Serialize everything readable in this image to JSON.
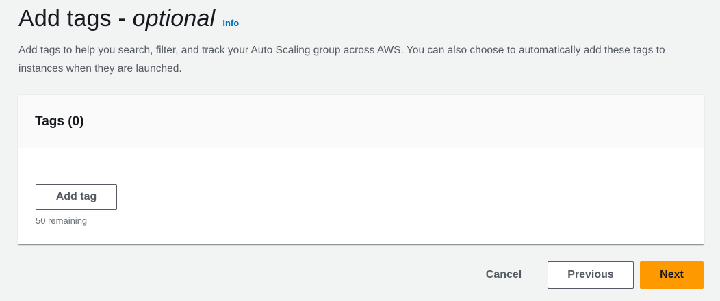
{
  "header": {
    "title_main": "Add tags - ",
    "title_optional": "optional",
    "info_link": "Info",
    "description": "Add tags to help you search, filter, and track your Auto Scaling group across AWS. You can also choose to automatically add these tags to instances when they are launched."
  },
  "tags_panel": {
    "title": "Tags (0)",
    "add_tag_label": "Add tag",
    "remaining_text": "50 remaining"
  },
  "footer": {
    "cancel_label": "Cancel",
    "previous_label": "Previous",
    "next_label": "Next"
  },
  "colors": {
    "background": "#f2f3f3",
    "link": "#0073bb",
    "primary_button": "#ff9900",
    "text_secondary": "#545b64"
  }
}
